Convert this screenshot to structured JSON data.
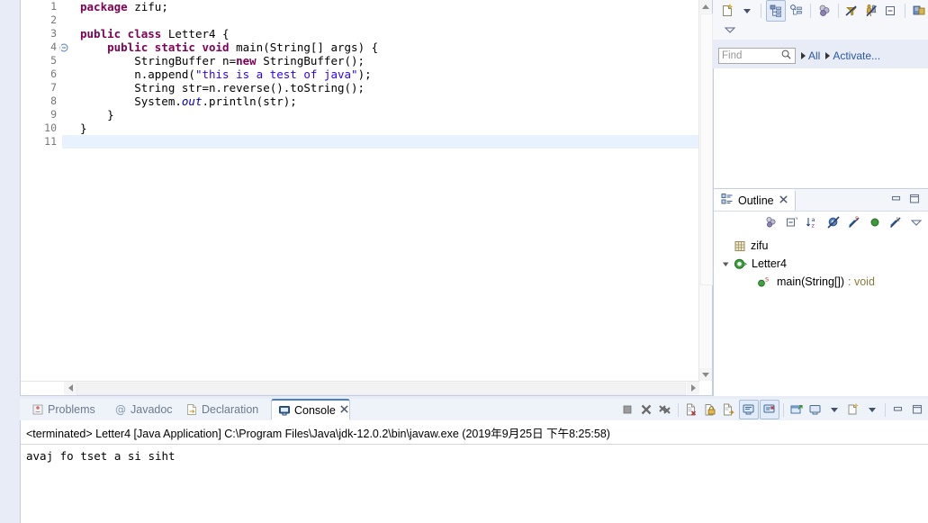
{
  "editor": {
    "gutter_lines": [
      "1",
      "2",
      "3",
      "4",
      "5",
      "6",
      "7",
      "8",
      "9",
      "10",
      "11"
    ],
    "fold_line": "4",
    "current_line": "11",
    "code_lines": [
      {
        "n": "1",
        "segments": [
          {
            "t": "package ",
            "c": "kw"
          },
          {
            "t": "zifu;",
            "c": "plain"
          }
        ]
      },
      {
        "n": "2",
        "segments": [
          {
            "t": "",
            "c": "plain"
          }
        ]
      },
      {
        "n": "3",
        "segments": [
          {
            "t": "public class ",
            "c": "kw"
          },
          {
            "t": "Letter4 {",
            "c": "plain"
          }
        ]
      },
      {
        "n": "4",
        "segments": [
          {
            "t": "    ",
            "c": "plain"
          },
          {
            "t": "public static void ",
            "c": "kw"
          },
          {
            "t": "main(String[] args) {",
            "c": "plain"
          }
        ]
      },
      {
        "n": "5",
        "segments": [
          {
            "t": "        StringBuffer n=",
            "c": "plain"
          },
          {
            "t": "new",
            "c": "kw"
          },
          {
            "t": " StringBuffer();",
            "c": "plain"
          }
        ]
      },
      {
        "n": "6",
        "segments": [
          {
            "t": "        n.append(",
            "c": "plain"
          },
          {
            "t": "\"this is a test of java\"",
            "c": "str"
          },
          {
            "t": ");",
            "c": "plain"
          }
        ]
      },
      {
        "n": "7",
        "segments": [
          {
            "t": "        String str=n.reverse().toString();",
            "c": "plain"
          }
        ]
      },
      {
        "n": "8",
        "segments": [
          {
            "t": "        System.",
            "c": "plain"
          },
          {
            "t": "out",
            "c": "stat"
          },
          {
            "t": ".println(str);",
            "c": "plain"
          }
        ]
      },
      {
        "n": "9",
        "segments": [
          {
            "t": "    }",
            "c": "plain"
          }
        ]
      },
      {
        "n": "10",
        "segments": [
          {
            "t": "}",
            "c": "plain"
          }
        ]
      },
      {
        "n": "11",
        "segments": [
          {
            "t": "",
            "c": "plain"
          }
        ]
      }
    ]
  },
  "toolbar": {
    "icons": [
      {
        "name": "new-wizard-icon",
        "label": "New"
      },
      {
        "name": "new-wizard-dropdown-icon",
        "label": "New dropdown"
      },
      {
        "name": "link-with-editor-icon",
        "label": "Link with Editor"
      },
      {
        "name": "view-menu-tree-icon",
        "label": "Tree view"
      },
      {
        "name": "collapse-members-icon",
        "label": "Collapse"
      },
      {
        "name": "filter-icon",
        "label": "Filters"
      },
      {
        "name": "hide-fields-icon",
        "label": "Hide Fields"
      },
      {
        "name": "collapse-all-icon",
        "label": "Collapse All"
      },
      {
        "name": "debug-icon",
        "label": "Debug"
      }
    ],
    "overflow_label": "More"
  },
  "find": {
    "placeholder": "Find",
    "search_icon": "search-icon",
    "all_label": "All",
    "activate_label": "Activate..."
  },
  "outline": {
    "tab_label": "Outline",
    "close_icon": "close-icon",
    "minimize_label": "Minimize",
    "maximize_label": "Maximize",
    "toolbar_icons": [
      {
        "name": "focus-on-active-task-icon"
      },
      {
        "name": "collapse-all-icon"
      },
      {
        "name": "sort-alphabetically-icon"
      },
      {
        "name": "hide-fields-icon"
      },
      {
        "name": "hide-static-members-icon"
      },
      {
        "name": "hide-non-public-members-icon"
      },
      {
        "name": "hide-local-types-icon"
      },
      {
        "name": "view-menu-icon"
      }
    ],
    "tree": [
      {
        "icon": "package-icon",
        "label": "zifu",
        "indent": 0,
        "arrow": false,
        "ret": ""
      },
      {
        "icon": "class-icon",
        "label": "Letter4",
        "indent": 0,
        "arrow": true,
        "ret": ""
      },
      {
        "icon": "method-icon",
        "label": "main(String[])",
        "indent": 1,
        "arrow": false,
        "ret": " : void"
      }
    ]
  },
  "bottom": {
    "tabs": [
      {
        "label": "Problems",
        "icon": "problems-icon",
        "active": false
      },
      {
        "label": "Javadoc",
        "icon": "javadoc-icon",
        "active": false
      },
      {
        "label": "Declaration",
        "icon": "declaration-icon",
        "active": false
      },
      {
        "label": "Console",
        "icon": "console-icon",
        "active": true
      }
    ],
    "active_tab_close_icon": "close-icon",
    "toolbar_icons": [
      {
        "name": "terminate-icon"
      },
      {
        "name": "remove-launch-icon"
      },
      {
        "name": "remove-all-terminated-icon"
      },
      {
        "name": "clear-console-icon"
      },
      {
        "name": "scroll-lock-icon"
      },
      {
        "name": "word-wrap-icon"
      },
      {
        "name": "show-console-on-output-icon"
      },
      {
        "name": "show-console-on-error-icon"
      },
      {
        "name": "pin-console-icon"
      },
      {
        "name": "display-selected-console-icon"
      },
      {
        "name": "display-selected-console-dropdown-icon"
      },
      {
        "name": "open-console-icon"
      },
      {
        "name": "open-console-dropdown-icon"
      },
      {
        "name": "minimize-icon"
      },
      {
        "name": "maximize-icon"
      }
    ]
  },
  "console": {
    "header": "<terminated> Letter4 [Java Application] C:\\Program Files\\Java\\jdk-12.0.2\\bin\\javaw.exe (2019年9月25日 下午8:25:58)",
    "output": "avaj fo tset a si siht"
  },
  "colors": {
    "keyword": "#7f0055",
    "string": "#2a00ff",
    "static_field": "#0000c0",
    "link": "#2a57a4",
    "current_line_bg": "#e8f2fe",
    "workbench_bg": "#e8ecf7",
    "return_type": "#8a7a3a"
  }
}
